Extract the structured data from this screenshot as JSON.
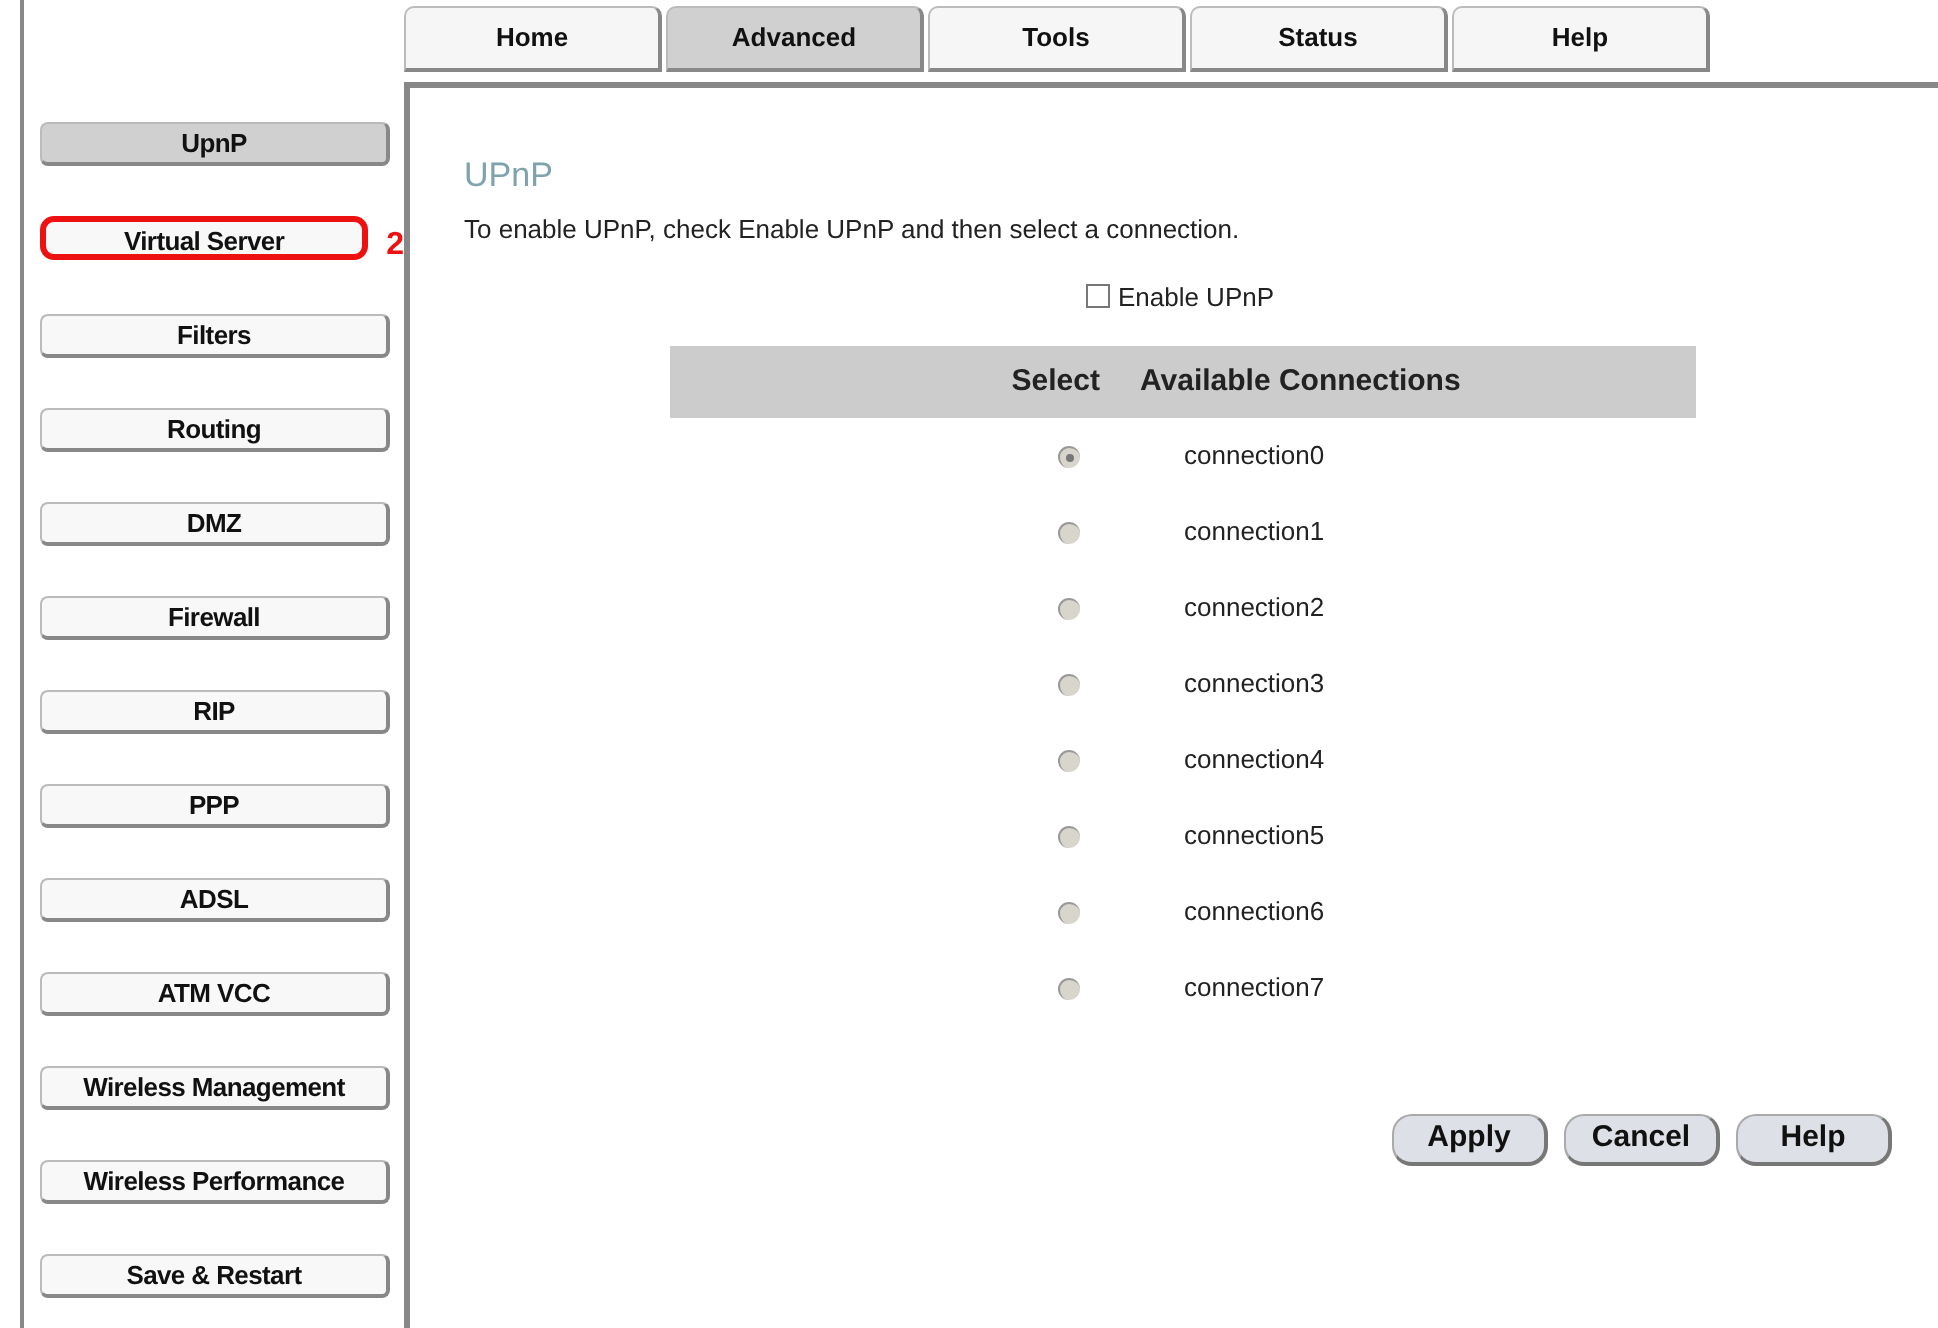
{
  "top_tabs": [
    {
      "label": "Home",
      "selected": false
    },
    {
      "label": "Advanced",
      "selected": true
    },
    {
      "label": "Tools",
      "selected": false
    },
    {
      "label": "Status",
      "selected": false
    },
    {
      "label": "Help",
      "selected": false
    }
  ],
  "sidebar": {
    "items": [
      {
        "label": "UpnP",
        "selected": true,
        "highlighted": false
      },
      {
        "label": "Virtual Server",
        "selected": false,
        "highlighted": true,
        "annotation": "2"
      },
      {
        "label": "Filters",
        "selected": false,
        "highlighted": false
      },
      {
        "label": "Routing",
        "selected": false,
        "highlighted": false
      },
      {
        "label": "DMZ",
        "selected": false,
        "highlighted": false
      },
      {
        "label": "Firewall",
        "selected": false,
        "highlighted": false
      },
      {
        "label": "RIP",
        "selected": false,
        "highlighted": false
      },
      {
        "label": "PPP",
        "selected": false,
        "highlighted": false
      },
      {
        "label": "ADSL",
        "selected": false,
        "highlighted": false
      },
      {
        "label": "ATM VCC",
        "selected": false,
        "highlighted": false
      },
      {
        "label": "Wireless Management",
        "selected": false,
        "highlighted": false
      },
      {
        "label": "Wireless Performance",
        "selected": false,
        "highlighted": false
      },
      {
        "label": "Save & Restart",
        "selected": false,
        "highlighted": false
      }
    ]
  },
  "content": {
    "title": "UPnP",
    "description": "To enable UPnP, check Enable UPnP and then select a connection.",
    "enable_checkbox": {
      "label": "Enable UPnP",
      "checked": false
    },
    "table": {
      "columns": [
        "Select",
        "Available Connections"
      ],
      "rows": [
        {
          "connection": "connection0",
          "selected": true
        },
        {
          "connection": "connection1",
          "selected": false
        },
        {
          "connection": "connection2",
          "selected": false
        },
        {
          "connection": "connection3",
          "selected": false
        },
        {
          "connection": "connection4",
          "selected": false
        },
        {
          "connection": "connection5",
          "selected": false
        },
        {
          "connection": "connection6",
          "selected": false
        },
        {
          "connection": "connection7",
          "selected": false
        }
      ]
    },
    "buttons": [
      "Apply",
      "Cancel",
      "Help"
    ]
  }
}
